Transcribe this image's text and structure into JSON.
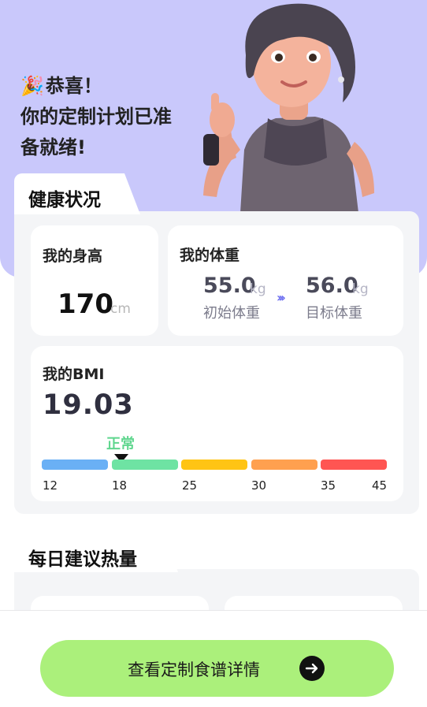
{
  "hero": {
    "line1": "恭喜！",
    "line2": "你的定制计划已准",
    "line3": "备就绪!"
  },
  "health": {
    "section_title": "健康状况",
    "height": {
      "label": "我的身高",
      "value": "170",
      "unit": "cm"
    },
    "weight": {
      "label": "我的体重",
      "initial_value": "55.0",
      "initial_unit": "kg",
      "initial_caption": "初始体重",
      "target_value": "56.0",
      "target_unit": "kg",
      "target_caption": "目标体重",
      "arrow_icon": "triple-chevron-right-icon"
    },
    "bmi": {
      "label": "我的BMI",
      "value": "19.03",
      "status": "正常",
      "scale_ticks": [
        "12",
        "18",
        "25",
        "30",
        "35",
        "45"
      ],
      "scale_colors": [
        "#6ab0f5",
        "#6ee3a3",
        "#ffc414",
        "#ffa04f",
        "#ff5552"
      ]
    }
  },
  "calories": {
    "section_title": "每日建议热量"
  },
  "cta": {
    "label": "查看定制食谱详情",
    "icon": "arrow-right-icon"
  },
  "colors": {
    "hero_bg": "#c9c8fb",
    "accent_green": "#abf07b",
    "status_green": "#5fd68e"
  }
}
